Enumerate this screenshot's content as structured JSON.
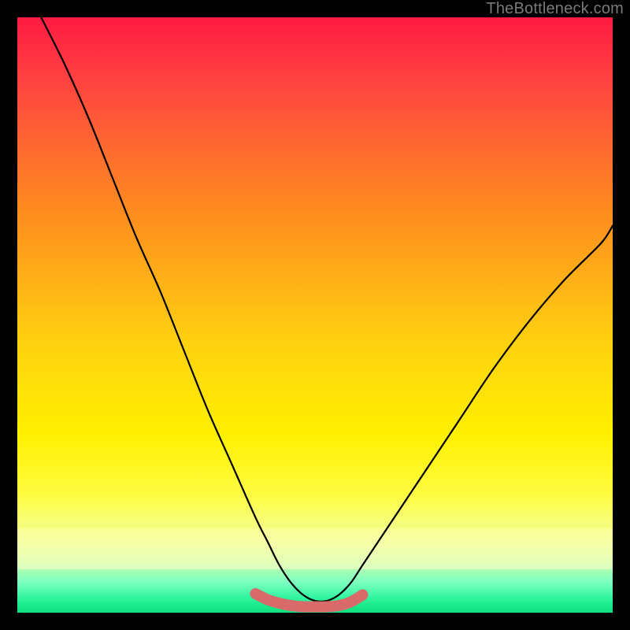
{
  "watermark": "TheBottleneck.com",
  "chart_data": {
    "type": "line",
    "title": "",
    "xlabel": "",
    "ylabel": "",
    "xlim": [
      0,
      100
    ],
    "ylim": [
      0,
      100
    ],
    "grid": false,
    "note": "Smooth V-shaped curve plotted over a vertical green-to-red gradient; values estimated from pixel positions (percent of plot area).",
    "series": [
      {
        "name": "curve",
        "color": "#000000",
        "x": [
          4,
          8,
          12,
          16,
          20,
          24,
          28,
          32,
          36,
          40,
          42,
          44,
          46,
          48,
          50,
          52,
          54,
          56,
          58,
          62,
          68,
          74,
          80,
          86,
          92,
          98,
          100
        ],
        "values": [
          100,
          92,
          83,
          73,
          63,
          54,
          44,
          34,
          25,
          16,
          12,
          8,
          5,
          3,
          2,
          2,
          3,
          5,
          8,
          14,
          23,
          32,
          41,
          49,
          56,
          62,
          65
        ]
      }
    ],
    "highlight": {
      "name": "bottom-segment",
      "color": "#e06666",
      "x_range": [
        40,
        58
      ],
      "y_range": [
        0.5,
        3.5
      ]
    },
    "background_gradient": {
      "top": "#ff1a43",
      "upper_mid": "#ffaa18",
      "mid": "#fff000",
      "lower_mid": "#f7ff7a",
      "bottom": "#10df80"
    }
  }
}
